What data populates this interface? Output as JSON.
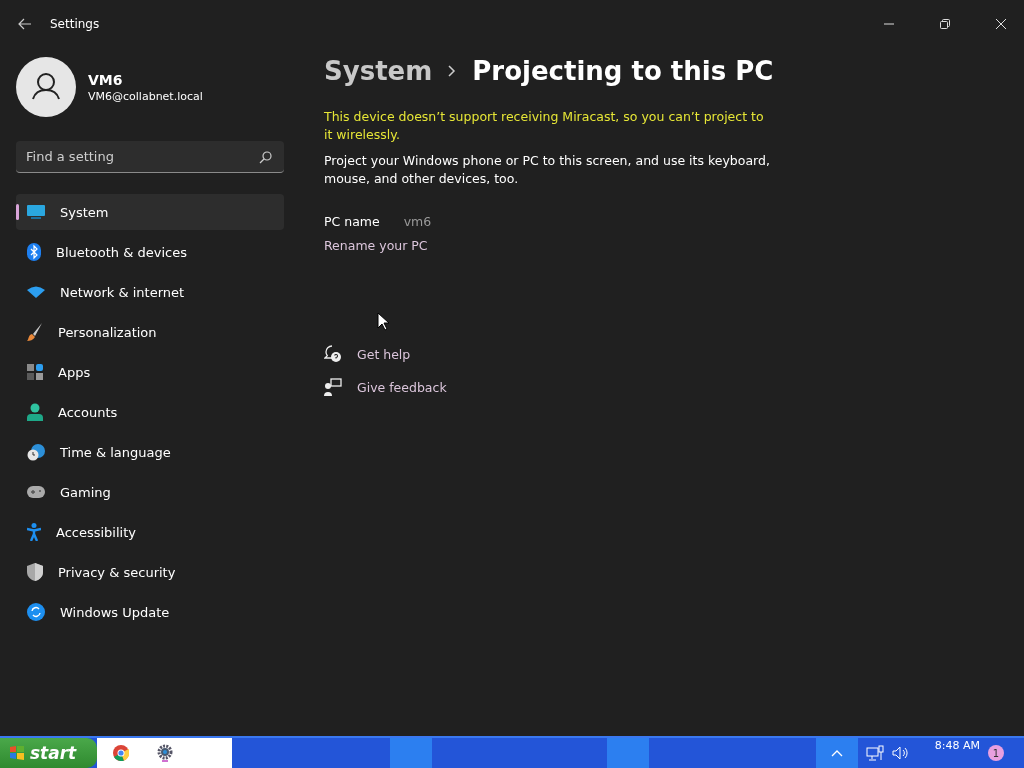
{
  "window": {
    "title": "Settings"
  },
  "profile": {
    "name": "VM6",
    "email": "VM6@collabnet.local"
  },
  "search": {
    "placeholder": "Find a setting"
  },
  "nav": [
    {
      "label": "System",
      "selected": true
    },
    {
      "label": "Bluetooth & devices",
      "selected": false
    },
    {
      "label": "Network & internet",
      "selected": false
    },
    {
      "label": "Personalization",
      "selected": false
    },
    {
      "label": "Apps",
      "selected": false
    },
    {
      "label": "Accounts",
      "selected": false
    },
    {
      "label": "Time & language",
      "selected": false
    },
    {
      "label": "Gaming",
      "selected": false
    },
    {
      "label": "Accessibility",
      "selected": false
    },
    {
      "label": "Privacy & security",
      "selected": false
    },
    {
      "label": "Windows Update",
      "selected": false
    }
  ],
  "breadcrumb": {
    "parent": "System",
    "current": "Projecting to this PC"
  },
  "warning": "This device doesn’t support receiving Miracast, so you can’t project to it wirelessly.",
  "description": "Project your Windows phone or PC to this screen, and use its keyboard, mouse, and other devices, too.",
  "pc_name": {
    "label": "PC name",
    "value": "vm6"
  },
  "rename_link": "Rename your PC",
  "help_links": [
    "Get help",
    "Give feedback"
  ],
  "taskbar": {
    "start": "start",
    "time": "8:48 AM",
    "notification_count": "1"
  }
}
